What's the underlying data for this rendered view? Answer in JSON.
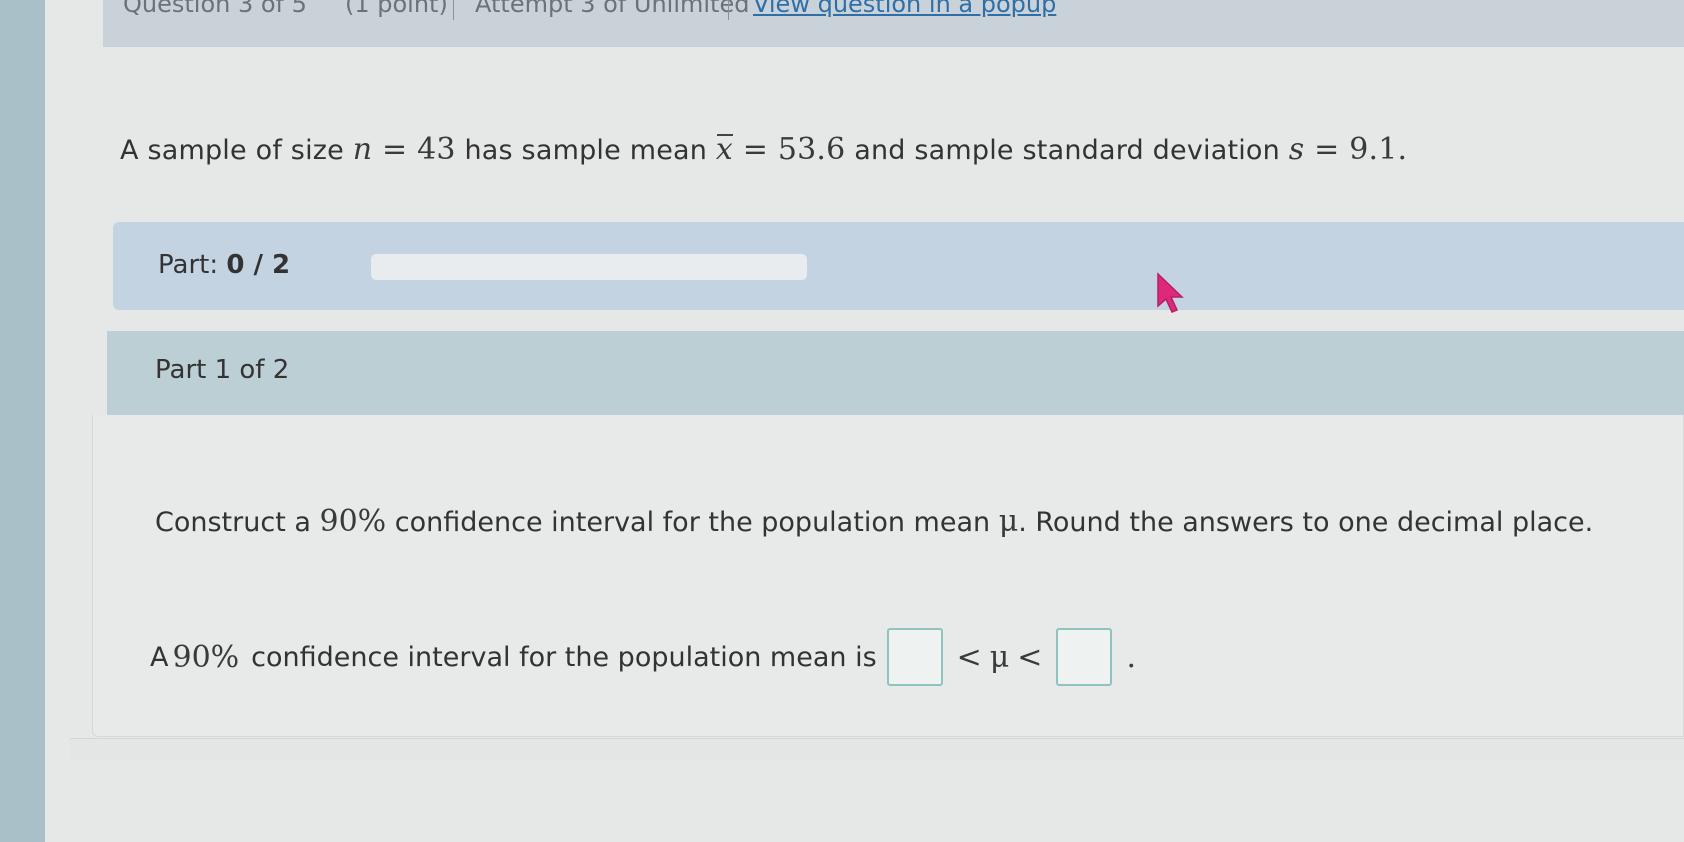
{
  "header": {
    "question": "Question 3 of 5",
    "points": "(1 point)",
    "attempt": "Attempt 3 of Unlimited",
    "popup_link": "View question in a popup"
  },
  "prompt": {
    "t1": "A sample of size ",
    "n_var": "n",
    "eq": " = ",
    "n_val": "43",
    "t2": " has sample mean ",
    "xbar_var": "x",
    "mean_val": "53.6",
    "t3": " and sample standard deviation ",
    "s_var": "s",
    "s_val": "9.1",
    "end": "."
  },
  "progress": {
    "label": "Part: ",
    "value": "0 / 2",
    "fraction_complete": 0
  },
  "part_header": "Part 1 of 2",
  "instruction": {
    "t1": "Construct a ",
    "pct": "90%",
    "t2": " confidence interval for the population mean ",
    "mu": "μ",
    "t3": ". Round the answers to one decimal place."
  },
  "answer": {
    "t1": "A ",
    "pct": "90%",
    "t2": " confidence interval for the population mean is",
    "lt1": "<",
    "mu": "μ",
    "lt2": "<",
    "end": ".",
    "lower_value": "",
    "upper_value": ""
  },
  "colors": {
    "link": "#2f6fa8",
    "progress_bar_bg": "#c3d3e2",
    "part_header_bg": "#bccfd4",
    "input_border": "#8fc3c0",
    "cursor": "#e0287a"
  },
  "icons": {
    "cursor": "pointer-cursor-icon"
  }
}
